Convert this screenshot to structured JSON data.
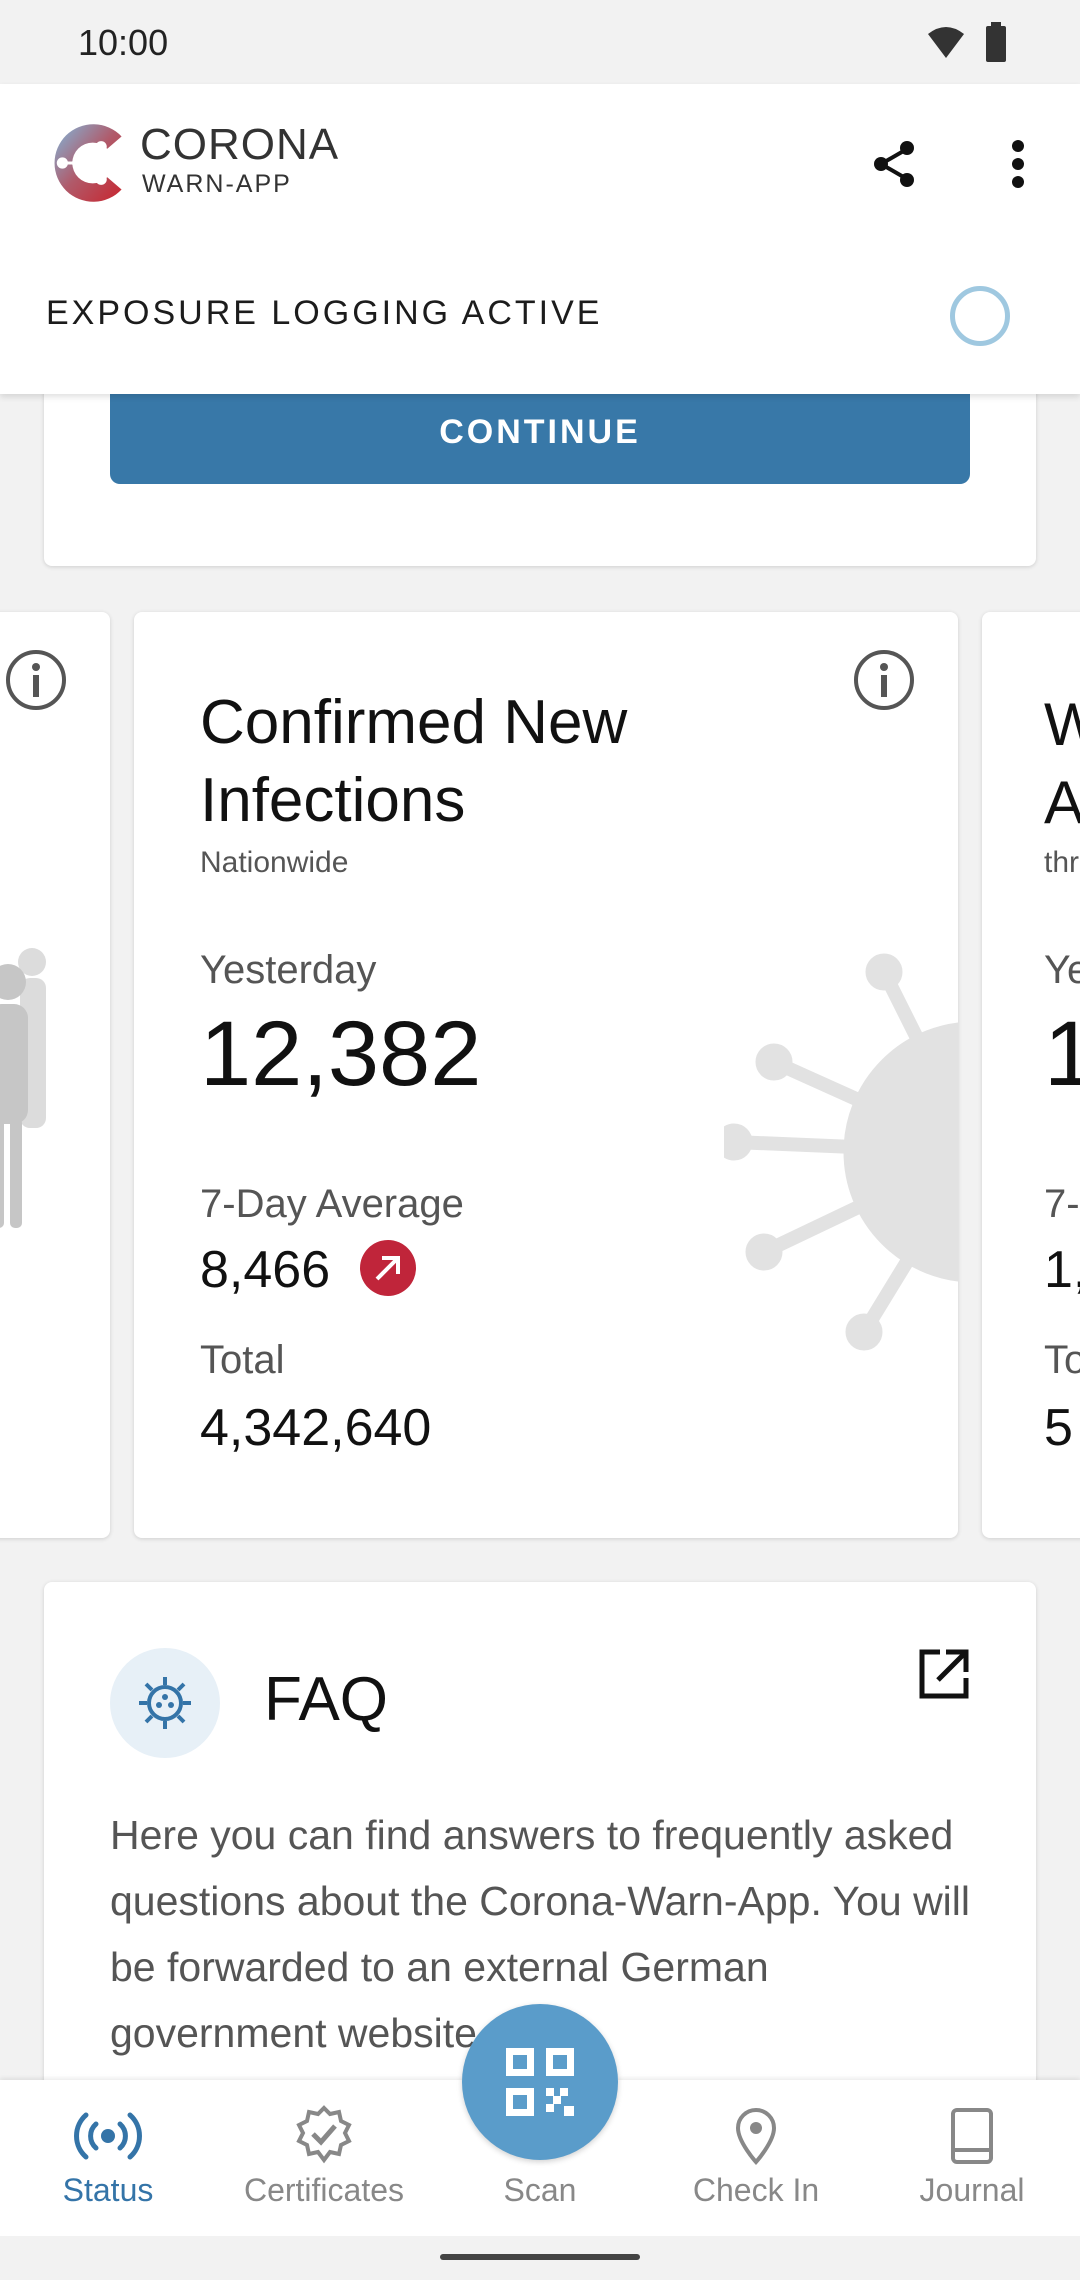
{
  "status_bar": {
    "time": "10:00",
    "icons": [
      "wifi-icon",
      "battery-icon"
    ]
  },
  "header": {
    "logo_title": "CORONA",
    "logo_subtitle": "WARN-APP",
    "actions": [
      "share-icon",
      "more-vert-icon"
    ],
    "exposure_status": "EXPOSURE LOGGING ACTIVE"
  },
  "top_card": {
    "button_label": "CONTINUE"
  },
  "stats": {
    "main": {
      "title": "Confirmed New Infections",
      "subtitle": "Nationwide",
      "yesterday_label": "Yesterday",
      "yesterday_value": "12,382",
      "avg_label": "7-Day Average",
      "avg_value": "8,466",
      "trend": "increasing",
      "total_label": "Total",
      "total_value": "4,342,640"
    },
    "right_peek": {
      "title_fragment_1": "W",
      "title_fragment_2": "A",
      "subtitle_fragment": "thr",
      "label_fragment_1": "Ye",
      "value_fragment_1": "1",
      "label_fragment_2": "7-",
      "value_fragment_2": "1,",
      "label_fragment_3": "To",
      "value_fragment_3": "5"
    }
  },
  "faq": {
    "title": "FAQ",
    "body": "Here you can find answers to frequently asked questions about the Corona-Warn-App. You will be forwarded to an external German government website."
  },
  "bottom_nav": {
    "items": [
      {
        "label": "Status",
        "icon": "broadcast-icon",
        "active": true
      },
      {
        "label": "Certificates",
        "icon": "certificate-icon",
        "active": false
      },
      {
        "label": "Scan",
        "icon": "qr-code-icon",
        "active": false
      },
      {
        "label": "Check In",
        "icon": "location-pin-icon",
        "active": false
      },
      {
        "label": "Journal",
        "icon": "book-icon",
        "active": false
      }
    ]
  },
  "colors": {
    "accent": "#3878a8",
    "trend_up": "#c0253a",
    "fab": "#5a9cca",
    "nav_active": "#3474a8"
  }
}
